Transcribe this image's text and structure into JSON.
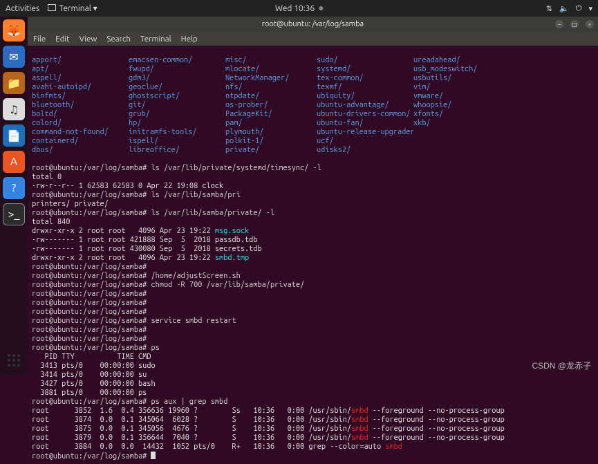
{
  "top_panel": {
    "activities": "Activities",
    "app_label": "Terminal ▾",
    "clock": "Wed 10:36"
  },
  "dock": {
    "apps": [
      "firefox",
      "thunderbird",
      "files",
      "rhythmbox",
      "libreoffice-writer",
      "software",
      "help",
      "terminal"
    ]
  },
  "window": {
    "title": "root@ubuntu: /var/log/samba"
  },
  "menubar": {
    "items": [
      "File",
      "Edit",
      "View",
      "Search",
      "Terminal",
      "Help"
    ]
  },
  "dir_columns": [
    [
      "apport/",
      "apt/",
      "aspell/",
      "avahi-autoipd/",
      "binfmts/",
      "bluetooth/",
      "boltd/",
      "colord/",
      "command-not-found/",
      "containerd/",
      "dbus/"
    ],
    [
      "emacsen-common/",
      "fwupd/",
      "gdm3/",
      "geoclue/",
      "ghostscript/",
      "git/",
      "grub/",
      "hp/",
      "initramfs-tools/",
      "ispell/",
      "libreoffice/"
    ],
    [
      "misc/",
      "mlocate/",
      "NetworkManager/",
      "nfs/",
      "ntpdate/",
      "os-prober/",
      "PackageKit/",
      "pam/",
      "plymouth/",
      "polkit-1/",
      "private/"
    ],
    [
      "sudo/",
      "systemd/",
      "tex-common/",
      "texmf/",
      "ubiquity/",
      "ubuntu-advantage/",
      "ubuntu-drivers-common/",
      "ubuntu-fan/",
      "ubuntu-release-upgrader/",
      "ucf/",
      "udisks2/"
    ],
    [
      "ureadahead/",
      "usb_modeswitch/",
      "usbutils/",
      "vim/",
      "vmware/",
      "whoopsie/",
      "xfonts/",
      "xkb/",
      "",
      "",
      ""
    ]
  ],
  "lines": {
    "p1": "root@ubuntu:/var/log/samba# ls /var/lib/private/systemd/timesync/ -l",
    "l1": "total 0",
    "l2": "-rw-r--r-- 1 62583 62583 0 Apr 22 19:08 clock",
    "p2": "root@ubuntu:/var/log/samba# ls /var/lib/samba/pri",
    "l3": "printers/ private/",
    "p3": "root@ubuntu:/var/log/samba# ls /var/lib/samba/private/ -l",
    "l4": "total 840",
    "l5a": "drwxr-xr-x 2 root root   4096 Apr 23 19:22 ",
    "l5b": "msg.sock",
    "l6": "-rw------- 1 root root 421888 Sep  5  2018 passdb.tdb",
    "l7": "-rw------- 1 root root 430080 Sep  5  2018 secrets.tdb",
    "l8a": "drwxr-xr-x 2 root root   4096 Apr 23 19:22 ",
    "l8b": "smbd.tmp",
    "p4": "root@ubuntu:/var/log/samba#",
    "p5": "root@ubuntu:/var/log/samba# /home/adjustScreen.sh",
    "p6": "root@ubuntu:/var/log/samba# chmod -R 700 /var/lib/samba/private/",
    "p7": "root@ubuntu:/var/log/samba#",
    "p8": "root@ubuntu:/var/log/samba#",
    "p9": "root@ubuntu:/var/log/samba#",
    "p10": "root@ubuntu:/var/log/samba# service smbd restart",
    "p11": "root@ubuntu:/var/log/samba#",
    "p12": "root@ubuntu:/var/log/samba#",
    "p13": "root@ubuntu:/var/log/samba# ps",
    "ps_hdr": "   PID TTY          TIME CMD",
    "ps1": "  3413 pts/0    00:00:00 sudo",
    "ps2": "  3414 pts/0    00:00:00 su",
    "ps3": "  3427 pts/0    00:00:00 bash",
    "ps4": "  3881 pts/0    00:00:00 ps",
    "p14": "root@ubuntu:/var/log/samba# ps aux | grep smbd",
    "g1a": "root      3852  1.6  0.4 356636 19960 ?        Ss   10:36   0:00 /usr/sbin/",
    "g1c": " --foreground --no-process-group",
    "g2a": "root      3874  0.0  0.1 345064  6028 ?        S    10:36   0:00 /usr/sbin/",
    "g3a": "root      3875  0.0  0.1 345056  4676 ?        S    10:36   0:00 /usr/sbin/",
    "g4a": "root      3879  0.0  0.1 356644  7040 ?        S    10:36   0:00 /usr/sbin/",
    "g5a": "root      3884  0.0  0.0  14432  1052 pts/0    R+   10:36   0:00 grep --color=auto ",
    "smbd": "smbd",
    "p15": "root@ubuntu:/var/log/samba# "
  },
  "watermark": "CSDN @龙赤子"
}
